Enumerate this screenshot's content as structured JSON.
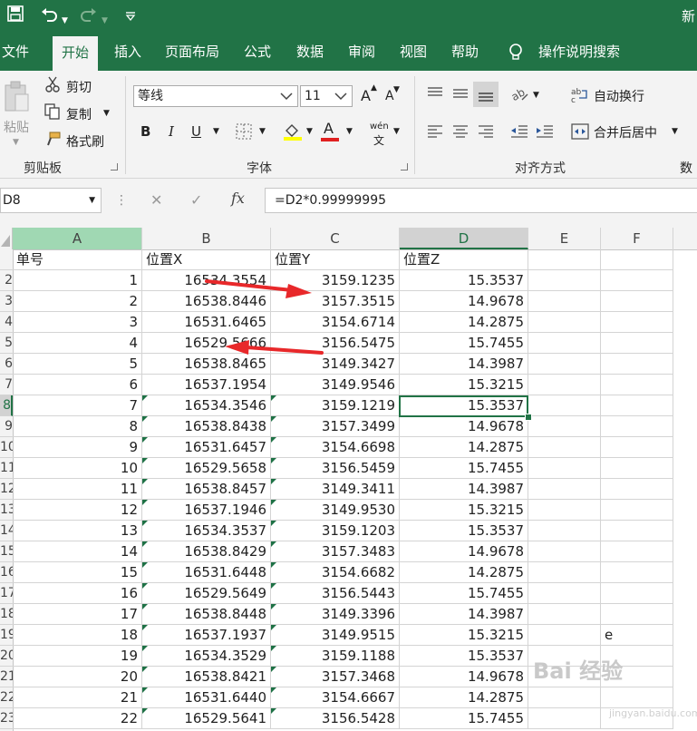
{
  "titlebar": {
    "save_icon": "save-icon",
    "undo_icon": "undo-icon",
    "redo_icon": "redo-icon",
    "customize_icon": "customize-qat-icon",
    "title_fragment": "新"
  },
  "tabs": [
    "文件",
    "开始",
    "插入",
    "页面布局",
    "公式",
    "数据",
    "审阅",
    "视图",
    "帮助"
  ],
  "active_tab": "开始",
  "tell_me": "操作说明搜索",
  "ribbon": {
    "clipboard": {
      "paste": "粘贴",
      "cut": "剪切",
      "copy": "复制",
      "format_painter": "格式刷",
      "label": "剪贴板"
    },
    "font": {
      "font_name": "等线",
      "font_size": "11",
      "grow": "A",
      "shrink": "A",
      "bold": "B",
      "italic": "I",
      "underline": "U",
      "font_color_letter": "A",
      "phonetic": "wén",
      "label": "字体"
    },
    "alignment": {
      "wrap_text": "自动换行",
      "merge_center": "合并后居中",
      "label": "对齐方式"
    },
    "more_label_fragment": "数"
  },
  "formula_bar": {
    "name_box": "D8",
    "cancel_icon": "✕",
    "enter_icon": "✓",
    "fx": "fx",
    "formula": "=D2*0.99999995"
  },
  "columns": [
    "A",
    "B",
    "C",
    "D",
    "E",
    "F"
  ],
  "headers": [
    "单号",
    "位置X",
    "位置Y",
    "位置Z"
  ],
  "row_numbers": [
    "2",
    "3",
    "4",
    "5",
    "6",
    "7",
    "8",
    "9",
    "10",
    "11",
    "12",
    "13",
    "14",
    "15",
    "16",
    "17",
    "18",
    "19",
    "20",
    "21",
    "22",
    "23"
  ],
  "rows": [
    [
      "1",
      "16534.3554",
      "3159.1235",
      "15.3537"
    ],
    [
      "2",
      "16538.8446",
      "3157.3515",
      "14.9678"
    ],
    [
      "3",
      "16531.6465",
      "3154.6714",
      "14.2875"
    ],
    [
      "4",
      "16529.5666",
      "3156.5475",
      "15.7455"
    ],
    [
      "5",
      "16538.8465",
      "3149.3427",
      "14.3987"
    ],
    [
      "6",
      "16537.1954",
      "3149.9546",
      "15.3215"
    ],
    [
      "7",
      "16534.3546",
      "3159.1219",
      "15.3537"
    ],
    [
      "8",
      "16538.8438",
      "3157.3499",
      "14.9678"
    ],
    [
      "9",
      "16531.6457",
      "3154.6698",
      "14.2875"
    ],
    [
      "10",
      "16529.5658",
      "3156.5459",
      "15.7455"
    ],
    [
      "11",
      "16538.8457",
      "3149.3411",
      "14.3987"
    ],
    [
      "12",
      "16537.1946",
      "3149.9530",
      "15.3215"
    ],
    [
      "13",
      "16534.3537",
      "3159.1203",
      "15.3537"
    ],
    [
      "14",
      "16538.8429",
      "3157.3483",
      "14.9678"
    ],
    [
      "15",
      "16531.6448",
      "3154.6682",
      "14.2875"
    ],
    [
      "16",
      "16529.5649",
      "3156.5443",
      "15.7455"
    ],
    [
      "17",
      "16538.8448",
      "3149.3396",
      "14.3987"
    ],
    [
      "18",
      "16537.1937",
      "3149.9515",
      "15.3215"
    ],
    [
      "19",
      "16534.3529",
      "3159.1188",
      "15.3537"
    ],
    [
      "20",
      "16538.8421",
      "3157.3468",
      "14.9678"
    ],
    [
      "21",
      "16531.6440",
      "3154.6667",
      "14.2875"
    ],
    [
      "22",
      "16529.5641",
      "3156.5428",
      "15.7455"
    ]
  ],
  "stray_cell_text": "e",
  "watermark": "Bai 经验",
  "watermark_url": "jingyan.baidu.com",
  "colors": {
    "excel_green": "#217346",
    "annotation_red": "#e8282a",
    "selected_header": "#d2d2d2"
  }
}
